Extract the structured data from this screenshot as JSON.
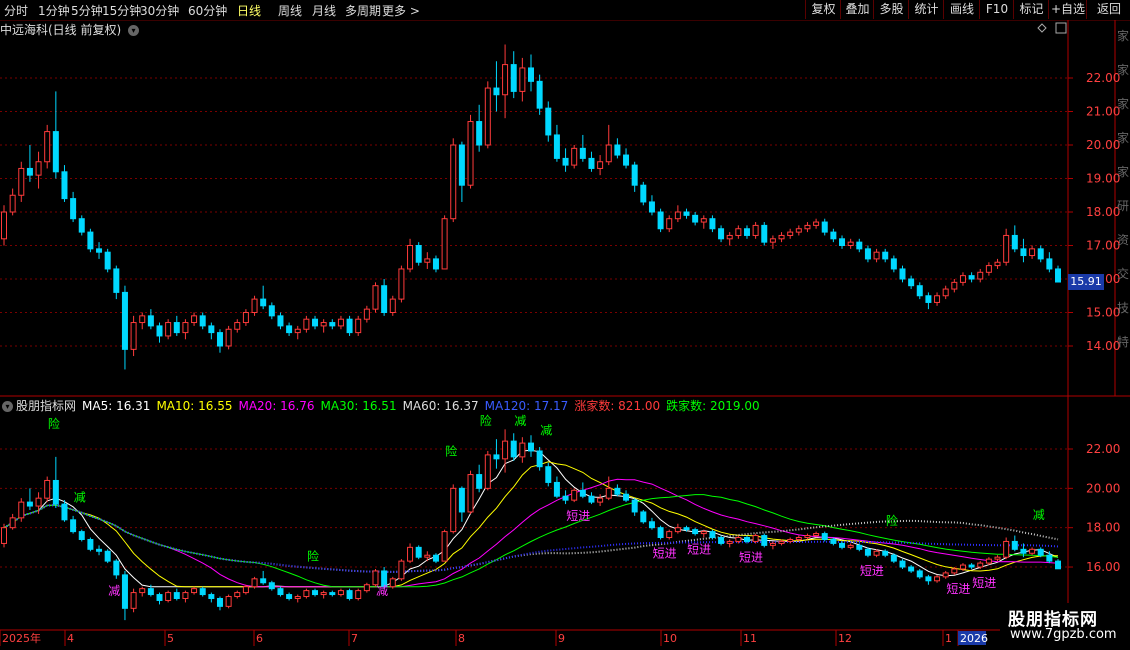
{
  "toolbar": {
    "periods": [
      "分时",
      "1分钟",
      "5分钟",
      "15分钟",
      "30分钟",
      "60分钟",
      "日线",
      "周线",
      "月线",
      "多周期",
      "更多 >"
    ],
    "active_period": "日线",
    "right_buttons": [
      "复权",
      "叠加",
      "多股",
      "统计",
      "画线",
      "F10",
      "标记",
      "+自选",
      "返回"
    ]
  },
  "chart_title": "中远海科(日线 前复权)",
  "current_price": "15.91",
  "main_y_ticks": [
    "22.00",
    "21.00",
    "20.00",
    "19.00",
    "18.00",
    "17.00",
    "16.00",
    "15.00",
    "14.00"
  ],
  "sub_y_ticks": [
    "22.00",
    "20.00",
    "18.00",
    "16.00"
  ],
  "x_labels": [
    "2025年",
    "4",
    "5",
    "6",
    "7",
    "8",
    "9",
    "10",
    "11",
    "12",
    "1",
    "2026"
  ],
  "right_strip_glyphs": [
    "家",
    "家",
    "家",
    "家",
    "家",
    "研",
    "资",
    "交",
    "技",
    "特"
  ],
  "indicator": {
    "name": "股朋指标网",
    "ma5": "MA5: 16.31",
    "ma10": "MA10: 16.55",
    "ma20": "MA20: 16.76",
    "ma30": "MA30: 16.51",
    "ma60": "MA60: 16.37",
    "ma120": "MA120: 17.17",
    "up_count": "涨家数: 821.00",
    "down_count": "跌家数: 2019.00"
  },
  "signals": {
    "xian": "险",
    "jian": "减",
    "duanjin": "短进"
  },
  "watermark": {
    "line1": "股朋指标网",
    "line2": "www.7gpzb.com"
  },
  "colors": {
    "up": "#ff3b3b",
    "down": "#00d8ff",
    "ma5": "#ffffff",
    "ma10": "#ffff00",
    "ma20": "#ff00ff",
    "ma30": "#00ff00",
    "ma60": "#c8c8c8",
    "ma120": "#3030ff",
    "grid": "#7a0000",
    "axis": "#b00000",
    "signal_green": "#00ff00",
    "signal_magenta": "#ff33ff"
  },
  "chart_data": {
    "type": "candlestick",
    "candles": [
      [
        17.2,
        18.2,
        17.0,
        18.0
      ],
      [
        18.0,
        18.7,
        17.9,
        18.5
      ],
      [
        18.5,
        19.5,
        18.3,
        19.3
      ],
      [
        19.3,
        20.0,
        18.9,
        19.1
      ],
      [
        19.1,
        19.8,
        18.7,
        19.5
      ],
      [
        19.5,
        20.6,
        19.3,
        20.4
      ],
      [
        20.4,
        21.6,
        19.0,
        19.2
      ],
      [
        19.2,
        19.4,
        18.3,
        18.4
      ],
      [
        18.4,
        18.6,
        17.7,
        17.8
      ],
      [
        17.8,
        17.9,
        17.3,
        17.4
      ],
      [
        17.4,
        17.5,
        16.8,
        16.9
      ],
      [
        16.9,
        17.1,
        16.6,
        16.8
      ],
      [
        16.8,
        16.9,
        16.2,
        16.3
      ],
      [
        16.3,
        16.4,
        15.4,
        15.6
      ],
      [
        15.6,
        15.8,
        13.3,
        13.9
      ],
      [
        13.9,
        14.9,
        13.7,
        14.7
      ],
      [
        14.7,
        15.0,
        14.5,
        14.9
      ],
      [
        14.9,
        15.1,
        14.5,
        14.6
      ],
      [
        14.6,
        14.7,
        14.1,
        14.3
      ],
      [
        14.3,
        14.8,
        14.2,
        14.7
      ],
      [
        14.7,
        14.9,
        14.3,
        14.4
      ],
      [
        14.4,
        14.8,
        14.2,
        14.7
      ],
      [
        14.7,
        15.0,
        14.6,
        14.9
      ],
      [
        14.9,
        15.0,
        14.5,
        14.6
      ],
      [
        14.6,
        14.7,
        14.2,
        14.4
      ],
      [
        14.4,
        14.5,
        13.8,
        14.0
      ],
      [
        14.0,
        14.6,
        13.9,
        14.5
      ],
      [
        14.5,
        14.8,
        14.4,
        14.7
      ],
      [
        14.7,
        15.1,
        14.6,
        15.0
      ],
      [
        15.0,
        15.5,
        14.9,
        15.4
      ],
      [
        15.4,
        15.8,
        15.1,
        15.2
      ],
      [
        15.2,
        15.3,
        14.8,
        14.9
      ],
      [
        14.9,
        15.0,
        14.5,
        14.6
      ],
      [
        14.6,
        14.7,
        14.3,
        14.4
      ],
      [
        14.4,
        14.6,
        14.2,
        14.5
      ],
      [
        14.5,
        14.9,
        14.4,
        14.8
      ],
      [
        14.8,
        14.9,
        14.5,
        14.6
      ],
      [
        14.6,
        14.8,
        14.4,
        14.7
      ],
      [
        14.7,
        14.8,
        14.5,
        14.6
      ],
      [
        14.6,
        14.9,
        14.5,
        14.8
      ],
      [
        14.8,
        14.9,
        14.3,
        14.4
      ],
      [
        14.4,
        14.9,
        14.3,
        14.8
      ],
      [
        14.8,
        15.2,
        14.7,
        15.1
      ],
      [
        15.1,
        15.9,
        15.0,
        15.8
      ],
      [
        15.8,
        16.0,
        14.9,
        15.0
      ],
      [
        15.0,
        15.5,
        14.9,
        15.4
      ],
      [
        15.4,
        16.4,
        15.3,
        16.3
      ],
      [
        16.3,
        17.2,
        16.2,
        17.0
      ],
      [
        17.0,
        17.1,
        16.4,
        16.5
      ],
      [
        16.5,
        16.8,
        16.3,
        16.6
      ],
      [
        16.6,
        16.7,
        16.2,
        16.3
      ],
      [
        16.3,
        17.9,
        16.3,
        17.8
      ],
      [
        17.8,
        20.2,
        17.7,
        20.0
      ],
      [
        20.0,
        20.1,
        18.3,
        18.8
      ],
      [
        18.8,
        20.9,
        18.7,
        20.7
      ],
      [
        20.7,
        21.2,
        19.8,
        20.0
      ],
      [
        20.0,
        21.9,
        19.9,
        21.7
      ],
      [
        21.7,
        22.5,
        21.0,
        21.5
      ],
      [
        21.5,
        23.0,
        20.8,
        22.4
      ],
      [
        22.4,
        22.8,
        21.4,
        21.6
      ],
      [
        21.6,
        22.6,
        21.3,
        22.3
      ],
      [
        22.3,
        22.7,
        21.6,
        21.9
      ],
      [
        21.9,
        22.1,
        20.9,
        21.1
      ],
      [
        21.1,
        21.3,
        20.1,
        20.3
      ],
      [
        20.3,
        20.6,
        19.5,
        19.6
      ],
      [
        19.6,
        19.9,
        19.2,
        19.4
      ],
      [
        19.4,
        20.0,
        19.3,
        19.9
      ],
      [
        19.9,
        20.3,
        19.5,
        19.6
      ],
      [
        19.6,
        19.8,
        19.2,
        19.3
      ],
      [
        19.3,
        19.7,
        19.1,
        19.5
      ],
      [
        19.5,
        20.6,
        19.4,
        20.0
      ],
      [
        20.0,
        20.2,
        19.6,
        19.7
      ],
      [
        19.7,
        19.9,
        19.3,
        19.4
      ],
      [
        19.4,
        19.5,
        18.6,
        18.8
      ],
      [
        18.8,
        18.9,
        18.2,
        18.3
      ],
      [
        18.3,
        18.5,
        17.9,
        18.0
      ],
      [
        18.0,
        18.1,
        17.4,
        17.5
      ],
      [
        17.5,
        17.9,
        17.4,
        17.8
      ],
      [
        17.8,
        18.2,
        17.7,
        18.0
      ],
      [
        18.0,
        18.1,
        17.8,
        17.9
      ],
      [
        17.9,
        18.0,
        17.6,
        17.7
      ],
      [
        17.7,
        17.9,
        17.5,
        17.8
      ],
      [
        17.8,
        17.9,
        17.4,
        17.5
      ],
      [
        17.5,
        17.6,
        17.1,
        17.2
      ],
      [
        17.2,
        17.4,
        17.0,
        17.3
      ],
      [
        17.3,
        17.6,
        17.2,
        17.5
      ],
      [
        17.5,
        17.6,
        17.2,
        17.3
      ],
      [
        17.3,
        17.7,
        17.2,
        17.6
      ],
      [
        17.6,
        17.7,
        17.0,
        17.1
      ],
      [
        17.1,
        17.3,
        16.9,
        17.2
      ],
      [
        17.2,
        17.4,
        17.1,
        17.3
      ],
      [
        17.3,
        17.5,
        17.2,
        17.4
      ],
      [
        17.4,
        17.6,
        17.3,
        17.5
      ],
      [
        17.5,
        17.7,
        17.4,
        17.6
      ],
      [
        17.6,
        17.8,
        17.5,
        17.7
      ],
      [
        17.7,
        17.8,
        17.3,
        17.4
      ],
      [
        17.4,
        17.5,
        17.1,
        17.2
      ],
      [
        17.2,
        17.3,
        16.9,
        17.0
      ],
      [
        17.0,
        17.2,
        16.9,
        17.1
      ],
      [
        17.1,
        17.2,
        16.8,
        16.9
      ],
      [
        16.9,
        17.0,
        16.5,
        16.6
      ],
      [
        16.6,
        16.9,
        16.5,
        16.8
      ],
      [
        16.8,
        16.9,
        16.5,
        16.6
      ],
      [
        16.6,
        16.7,
        16.2,
        16.3
      ],
      [
        16.3,
        16.4,
        15.9,
        16.0
      ],
      [
        16.0,
        16.1,
        15.7,
        15.8
      ],
      [
        15.8,
        15.9,
        15.4,
        15.5
      ],
      [
        15.5,
        15.6,
        15.1,
        15.3
      ],
      [
        15.3,
        15.6,
        15.2,
        15.5
      ],
      [
        15.5,
        15.8,
        15.4,
        15.7
      ],
      [
        15.7,
        16.0,
        15.6,
        15.9
      ],
      [
        15.9,
        16.2,
        15.8,
        16.1
      ],
      [
        16.1,
        16.2,
        15.9,
        16.0
      ],
      [
        16.0,
        16.3,
        15.9,
        16.2
      ],
      [
        16.2,
        16.5,
        16.1,
        16.4
      ],
      [
        16.4,
        16.6,
        16.3,
        16.5
      ],
      [
        16.5,
        17.5,
        16.4,
        17.3
      ],
      [
        17.3,
        17.6,
        16.8,
        16.9
      ],
      [
        16.9,
        17.2,
        16.5,
        16.7
      ],
      [
        16.7,
        17.0,
        16.6,
        16.9
      ],
      [
        16.9,
        17.0,
        16.5,
        16.6
      ],
      [
        16.6,
        16.8,
        16.2,
        16.3
      ],
      [
        16.3,
        16.4,
        15.9,
        15.91
      ]
    ]
  }
}
